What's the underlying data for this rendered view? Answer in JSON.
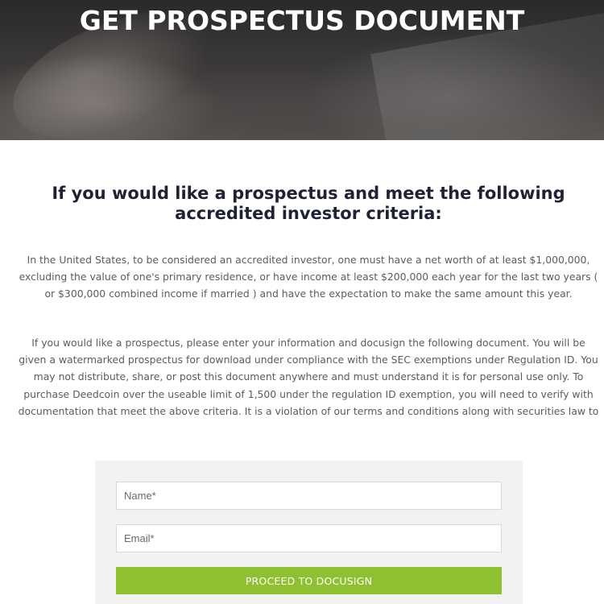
{
  "hero": {
    "title": "GET PROSPECTUS DOCUMENT"
  },
  "main": {
    "heading": "If you would like a prospectus and meet the following accredited investor criteria:",
    "paragraphs": [
      "In the United States, to be considered an accredited investor, one must have a net worth of at least $1,000,000, excluding the value of one's primary residence, or have income at least $200,000 each year for the last two years ( or $300,000 combined income if married ) and have the expectation to make the same amount this year.",
      "If you would like a prospectus, please enter your information and docusign the following document. You will be given a watermarked prospectus for download under compliance with the SEC exemptions under Regulation ID. You may not distribute, share, or post this document anywhere and must understand it is for personal use only. To purchase Deedcoin over the useable limit of 1,500 under the regulation ID exemption, you will need to verify with documentation that meet the above criteria. It is a violation of our terms and conditions along with securities law to"
    ]
  },
  "form": {
    "name_placeholder": "Name*",
    "email_placeholder": "Email*",
    "submit_label": "PROCEED TO DOCUSIGN",
    "button_color": "#8fc031"
  }
}
